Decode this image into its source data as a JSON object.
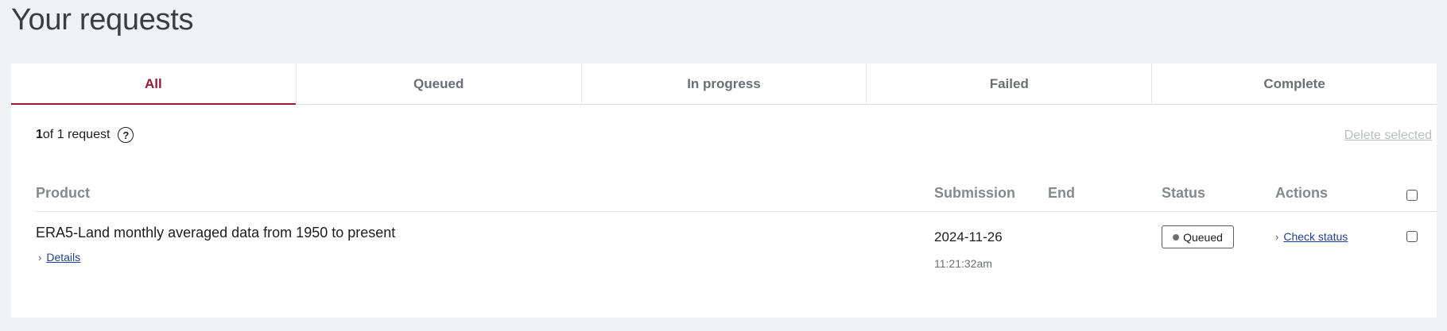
{
  "page": {
    "title": "Your requests"
  },
  "tabs": [
    {
      "label": "All",
      "active": true
    },
    {
      "label": "Queued",
      "active": false
    },
    {
      "label": "In progress",
      "active": false
    },
    {
      "label": "Failed",
      "active": false
    },
    {
      "label": "Complete",
      "active": false
    }
  ],
  "summary": {
    "count_bold": "1",
    "count_rest": " of 1 request",
    "help_glyph": "?",
    "delete_label": "Delete selected"
  },
  "table": {
    "columns": {
      "product": "Product",
      "submission": "Submission",
      "end": "End",
      "status": "Status",
      "actions": "Actions"
    },
    "rows": [
      {
        "product": "ERA5-Land monthly averaged data from 1950 to present",
        "details_label": "Details",
        "submission_date": "2024-11-26",
        "submission_time": "11:21:32am",
        "end": "",
        "status": "Queued",
        "action_label": "Check status"
      }
    ]
  },
  "icons": {
    "chevron": "›",
    "help": "question-circle-icon"
  },
  "colors": {
    "accent": "#9a1b35",
    "link": "#1f3f9a",
    "background": "#f0f1f5"
  }
}
